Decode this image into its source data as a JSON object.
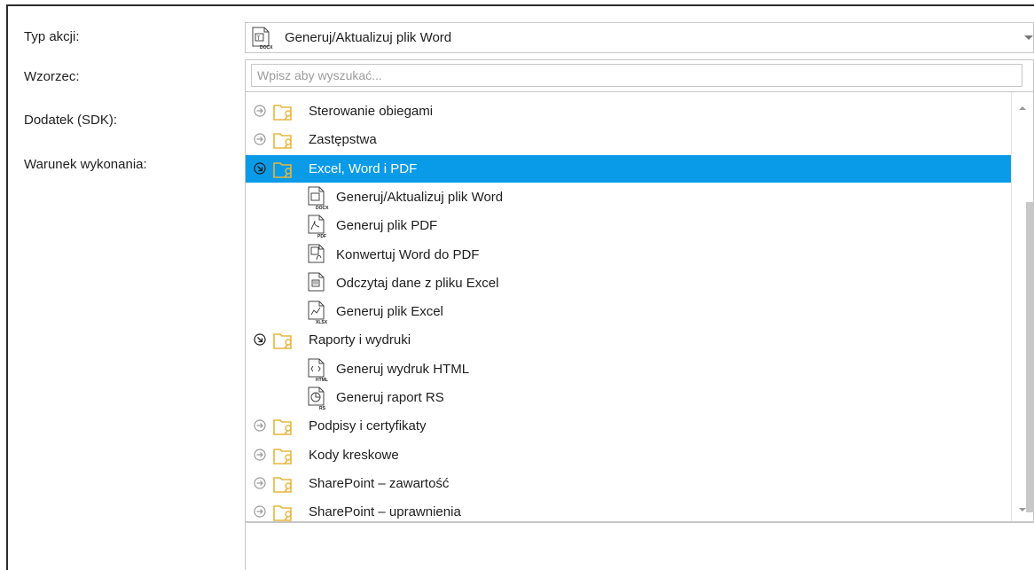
{
  "form": {
    "labels": {
      "action_type": "Typ akcji:",
      "template": "Wzorzec:",
      "addon": "Dodatek (SDK):",
      "condition": "Warunek wykonania:"
    },
    "action_type_value": "Generuj/Aktualizuj plik Word",
    "search_placeholder": "Wpisz aby wyszukać..."
  },
  "tree": {
    "items": [
      {
        "label": "Sterowanie obiegami",
        "kind": "group",
        "state": "collapsed"
      },
      {
        "label": "Zastępstwa",
        "kind": "group",
        "state": "collapsed"
      },
      {
        "label": "Excel, Word i PDF",
        "kind": "group",
        "state": "expanded",
        "selected": true
      },
      {
        "label": "Generuj/Aktualizuj plik Word",
        "kind": "action",
        "icon": "docx-icon"
      },
      {
        "label": "Generuj plik PDF",
        "kind": "action",
        "icon": "pdf-icon"
      },
      {
        "label": "Konwertuj Word do PDF",
        "kind": "action",
        "icon": "convert-icon"
      },
      {
        "label": "Odczytaj dane z pliku Excel",
        "kind": "action",
        "icon": "excel-read-icon"
      },
      {
        "label": "Generuj plik Excel",
        "kind": "action",
        "icon": "xlsx-icon"
      },
      {
        "label": "Raporty i wydruki",
        "kind": "group",
        "state": "expanded"
      },
      {
        "label": "Generuj wydruk HTML",
        "kind": "action",
        "icon": "html-icon"
      },
      {
        "label": "Generuj raport RS",
        "kind": "action",
        "icon": "rs-report-icon"
      },
      {
        "label": "Podpisy i certyfikaty",
        "kind": "group",
        "state": "collapsed"
      },
      {
        "label": "Kody kreskowe",
        "kind": "group",
        "state": "collapsed"
      },
      {
        "label": "SharePoint – zawartość",
        "kind": "group",
        "state": "collapsed"
      },
      {
        "label": "SharePoint – uprawnienia",
        "kind": "group",
        "state": "collapsed"
      }
    ]
  },
  "colors": {
    "selection": "#0a9be8",
    "folder": "#e8b53c",
    "border": "#c6c6c6"
  }
}
